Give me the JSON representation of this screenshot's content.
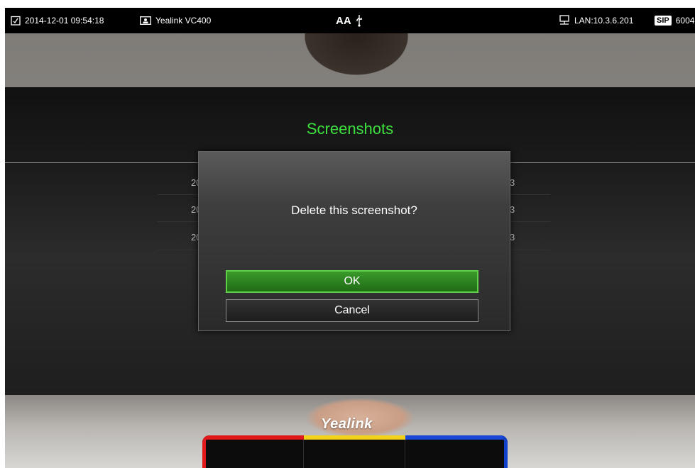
{
  "status_bar": {
    "datetime": "2014-12-01 09:54:18",
    "device_name": "Yealink VC400",
    "font_indicator": "AA",
    "lan": "LAN:10.3.6.201",
    "sip_badge": "SIP",
    "sip_number": "6004"
  },
  "panel": {
    "title": "Screenshots",
    "list_items": [
      {
        "left_fragment": "20",
        "right_fragment": "3"
      },
      {
        "left_fragment": "20",
        "right_fragment": "3"
      },
      {
        "left_fragment": "20",
        "right_fragment": "3"
      }
    ]
  },
  "dialog": {
    "message": "Delete this screenshot?",
    "ok_label": "OK",
    "cancel_label": "Cancel"
  },
  "logo": "Yealink",
  "softkeys": {
    "colors": [
      "#e0191b",
      "#f2d21a",
      "#1b46d6"
    ]
  },
  "colors": {
    "title_green": "#3ee03e",
    "ok_green": "#2d8a20",
    "ok_border": "#5fd24a"
  }
}
